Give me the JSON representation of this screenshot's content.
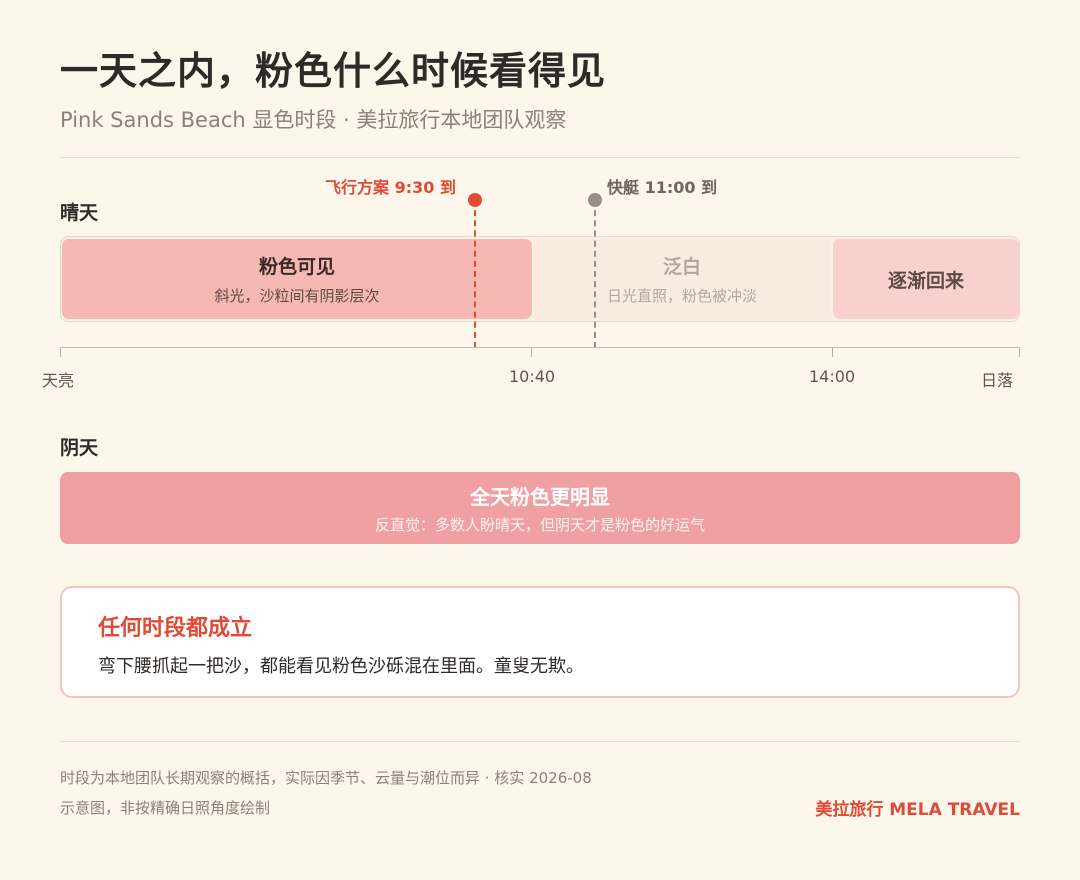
{
  "header": {
    "title": "一天之内，粉色什么时候看得见",
    "subtitle": "Pink Sands Beach 显色时段 · 美拉旅行本地团队观察"
  },
  "sunny": {
    "label": "晴天",
    "segments": [
      {
        "title": "粉色可见",
        "desc": "斜光，沙粒间有阴影层次"
      },
      {
        "title": "泛白",
        "desc": "日光直照，粉色被冲淡"
      },
      {
        "title": "逐渐回来",
        "desc": ""
      }
    ],
    "axis": [
      "天亮",
      "10:40",
      "14:00",
      "日落"
    ],
    "markers": [
      {
        "label": "飞行方案 9:30 到",
        "color": "#e04b36"
      },
      {
        "label": "快艇 11:00 到",
        "color": "#9a8f86"
      }
    ]
  },
  "overcast": {
    "label": "阴天",
    "title": "全天粉色更明显",
    "desc": "反直觉：多数人盼晴天，但阴天才是粉色的好运气"
  },
  "card": {
    "title": "任何时段都成立",
    "body": "弯下腰抓起一把沙，都能看见粉色沙砾混在里面。童叟无欺。"
  },
  "footer": {
    "note1": "时段为本地团队长期观察的概括，实际因季节、云量与潮位而异 · 核实 2026-08",
    "note2": "示意图，非按精确日照角度绘制",
    "brand": "美拉旅行 MELA TRAVEL"
  },
  "colors": {
    "accent": "#e04b36",
    "pink_visible": "#f6b8b2",
    "washed_out": "#f9ede0",
    "returning": "#f9d1cc",
    "overcast": "#f0a0a3"
  }
}
